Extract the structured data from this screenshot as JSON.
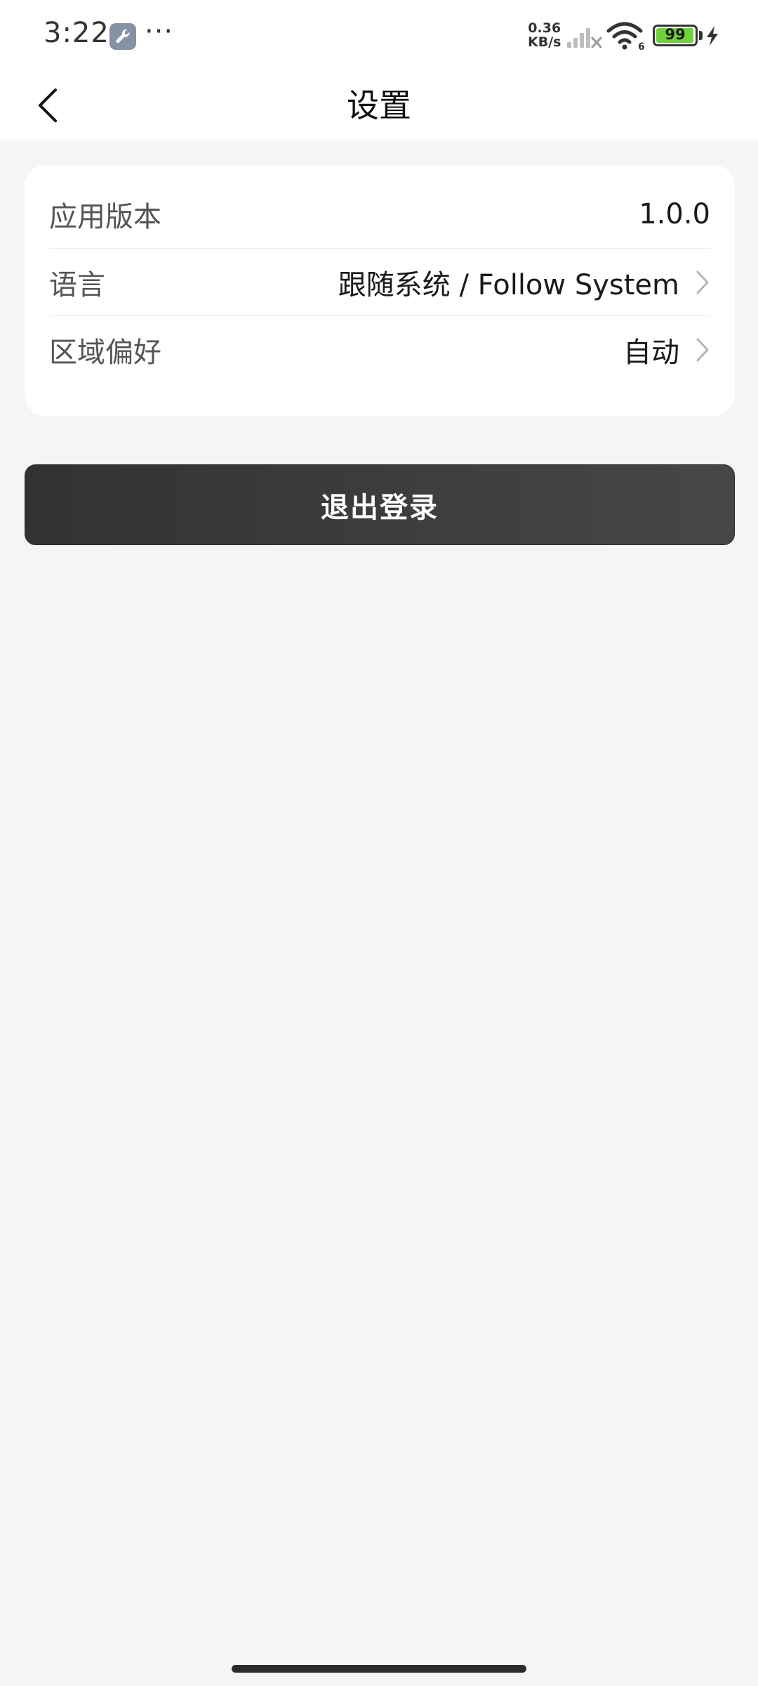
{
  "status_bar": {
    "time": "3:22",
    "more": "···",
    "net_speed_value": "0.36",
    "net_speed_unit": "KB/s",
    "wifi_label": "6",
    "battery_level": "99"
  },
  "header": {
    "title": "设置"
  },
  "settings": {
    "items": [
      {
        "label": "应用版本",
        "value": "1.0.0"
      },
      {
        "label": "语言",
        "value": "跟随系统 / Follow System"
      },
      {
        "label": "区域偏好",
        "value": "自动"
      }
    ]
  },
  "actions": {
    "logout_label": "退出登录"
  },
  "colors": {
    "background": "#f4f5f7",
    "card": "#ffffff",
    "button": "#3a3a3a",
    "battery": "#6fd23c"
  }
}
